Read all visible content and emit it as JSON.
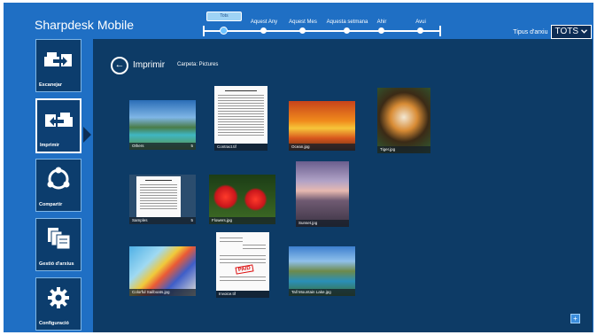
{
  "app": {
    "title": "Sharpdesk Mobile"
  },
  "timeline": {
    "current": "Tots",
    "labels": [
      "Aquest Any",
      "Aquest Mes",
      "Aquesta setmana",
      "Ahir",
      "Avui"
    ]
  },
  "filter": {
    "label": "Tipus d'arxiu",
    "value": "TOTS"
  },
  "sidebar": {
    "items": [
      {
        "label": "Escanejar",
        "icon": "scan-icon"
      },
      {
        "label": "Imprimir",
        "icon": "print-icon"
      },
      {
        "label": "Compartir",
        "icon": "share-icon"
      },
      {
        "label": "Gestió d'arxius",
        "icon": "file-management-icon"
      },
      {
        "label": "Configuració",
        "icon": "gear-icon"
      }
    ]
  },
  "content": {
    "title": "Imprimir",
    "subtitle": "Carpeta: Pictures",
    "items": [
      {
        "name": "Others",
        "count": "5"
      },
      {
        "name": "Contract.tif"
      },
      {
        "name": "Ocean.jpg"
      },
      {
        "name": "Tiger.jpg"
      },
      {
        "name": "Samples",
        "count": "5"
      },
      {
        "name": "Flowers.jpg"
      },
      {
        "name": "Sunset.jpg"
      },
      {
        "name": "Colorful Sailboats.jpg"
      },
      {
        "name": "Invoice.tif"
      },
      {
        "name": "Tall Mountain Lake.jpg"
      }
    ],
    "invoice_stamp": "PAID"
  },
  "colors": {
    "accent": "#1f6fc4",
    "panel": "#0d3b66"
  }
}
